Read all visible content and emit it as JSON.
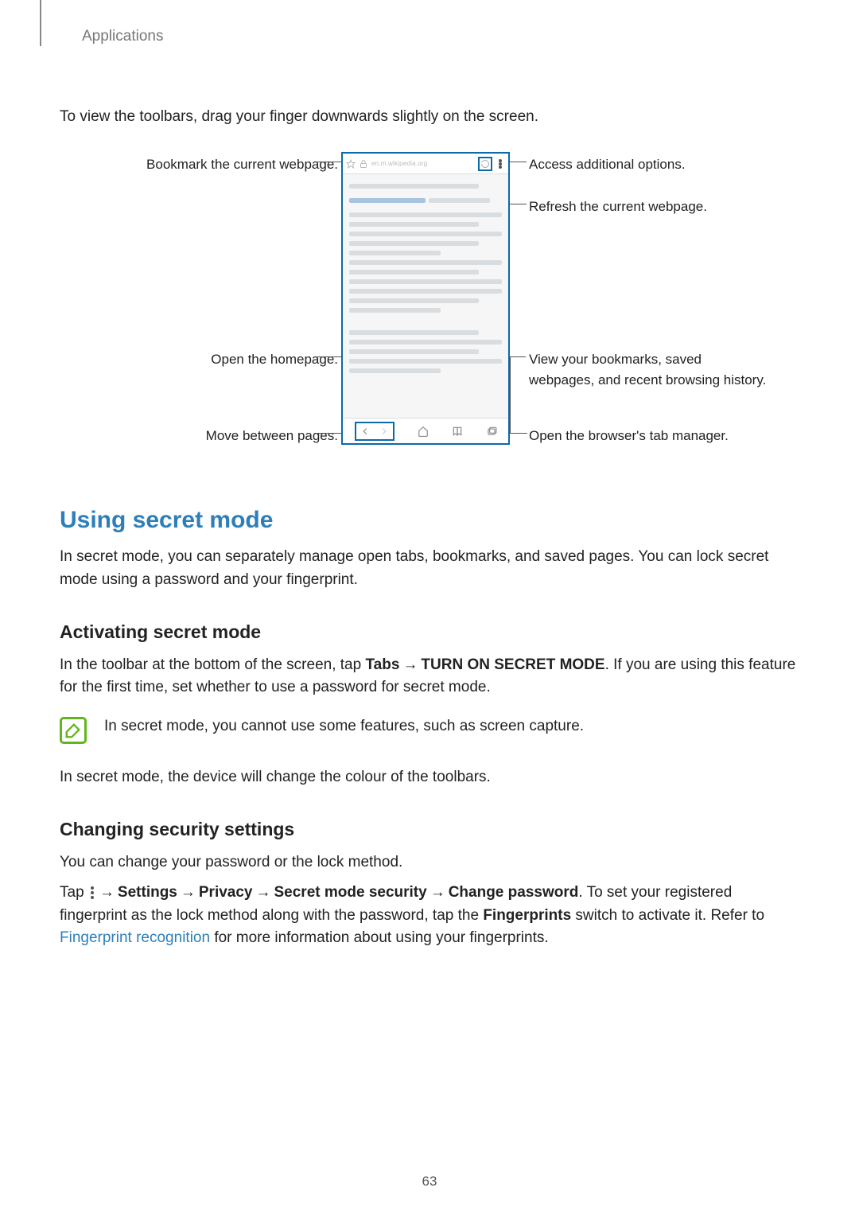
{
  "header": {
    "section": "Applications"
  },
  "intro": "To view the toolbars, drag your finger downwards slightly on the screen.",
  "diagram": {
    "left": {
      "bookmark": "Bookmark the current webpage.",
      "homepage": "Open the homepage.",
      "move_pages": "Move between pages."
    },
    "right": {
      "more": "Access additional options.",
      "refresh": "Refresh the current webpage.",
      "bookmarks_list": "View your bookmarks, saved webpages, and recent browsing history.",
      "tabs": "Open the browser's tab manager."
    },
    "url_text": "en.m.wikipedia.org"
  },
  "h2": "Using secret mode",
  "secret_intro": "In secret mode, you can separately manage open tabs, bookmarks, and saved pages. You can lock secret mode using a password and your fingerprint.",
  "activate": {
    "heading": "Activating secret mode",
    "pre": "In the toolbar at the bottom of the screen, tap ",
    "tabs": "Tabs",
    "arrow": "→",
    "turn_on": "TURN ON SECRET MODE",
    "post": ". If you are using this feature for the first time, set whether to use a password for secret mode.",
    "note": "In secret mode, you cannot use some features, such as screen capture.",
    "after_note": "In secret mode, the device will change the colour of the toolbars."
  },
  "security": {
    "heading": "Changing security settings",
    "p1": "You can change your password or the lock method.",
    "tap": "Tap ",
    "settings": "Settings",
    "privacy": "Privacy",
    "sms": "Secret mode security",
    "change_pw": "Change password",
    "after1": ". To set your registered fingerprint as the lock method along with the password, tap the ",
    "fingerprints": "Fingerprints",
    "after2": " switch to activate it. Refer to ",
    "link": "Fingerprint recognition",
    "after3": " for more information about using your fingerprints."
  },
  "page_number": "63"
}
